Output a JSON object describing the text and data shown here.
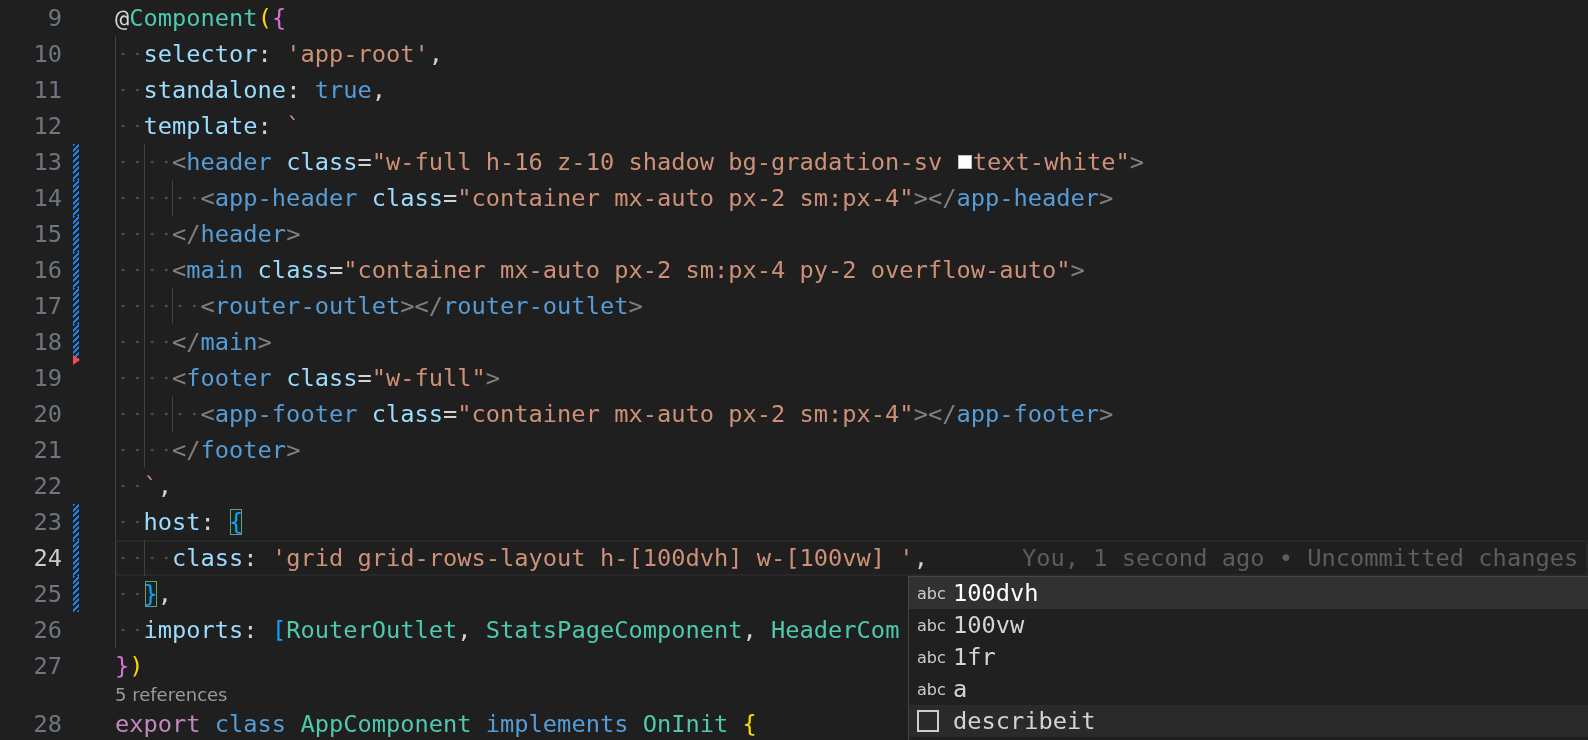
{
  "rows": [
    {
      "kind": "code",
      "number": "9",
      "current": false,
      "modified": false,
      "deleted_after": false,
      "tokens": [
        {
          "kind": "plain",
          "text": "@"
        },
        {
          "kind": "type",
          "text": "Component"
        },
        {
          "kind": "paren",
          "text": "("
        },
        {
          "kind": "brace",
          "text": "{"
        }
      ]
    },
    {
      "kind": "code",
      "number": "10",
      "current": false,
      "modified": false,
      "deleted_after": false,
      "tokens": [
        {
          "kind": "prop",
          "text": "  selector"
        },
        {
          "kind": "plain",
          "text": ": "
        },
        {
          "kind": "string",
          "text": "'app-root'"
        },
        {
          "kind": "plain",
          "text": ","
        }
      ]
    },
    {
      "kind": "code",
      "number": "11",
      "current": false,
      "modified": false,
      "deleted_after": false,
      "tokens": [
        {
          "kind": "prop",
          "text": "  standalone"
        },
        {
          "kind": "plain",
          "text": ": "
        },
        {
          "kind": "literal",
          "text": "true"
        },
        {
          "kind": "plain",
          "text": ","
        }
      ]
    },
    {
      "kind": "code",
      "number": "12",
      "current": false,
      "modified": false,
      "deleted_after": false,
      "tokens": [
        {
          "kind": "prop",
          "text": "  template"
        },
        {
          "kind": "plain",
          "text": ": "
        },
        {
          "kind": "string",
          "text": "`"
        }
      ]
    },
    {
      "kind": "code",
      "number": "13",
      "current": false,
      "modified": true,
      "deleted_after": false,
      "tokens": [
        {
          "kind": "punct",
          "text": "    <"
        },
        {
          "kind": "tag",
          "text": "header"
        },
        {
          "kind": "prop",
          "text": " class"
        },
        {
          "kind": "plain",
          "text": "="
        },
        {
          "kind": "string",
          "text": "\"w-full h-16 z-10 shadow bg-gradation-sv "
        },
        {
          "kind": "swatch",
          "color": "#ffffff"
        },
        {
          "kind": "string",
          "text": "text-white\""
        },
        {
          "kind": "punct",
          "text": ">"
        }
      ]
    },
    {
      "kind": "code",
      "number": "14",
      "current": false,
      "modified": true,
      "deleted_after": false,
      "tokens": [
        {
          "kind": "punct",
          "text": "      <"
        },
        {
          "kind": "tag",
          "text": "app-header"
        },
        {
          "kind": "prop",
          "text": " class"
        },
        {
          "kind": "plain",
          "text": "="
        },
        {
          "kind": "string",
          "text": "\"container mx-auto px-2 sm:px-4\""
        },
        {
          "kind": "punct",
          "text": "></"
        },
        {
          "kind": "tag",
          "text": "app-header"
        },
        {
          "kind": "punct",
          "text": ">"
        }
      ]
    },
    {
      "kind": "code",
      "number": "15",
      "current": false,
      "modified": true,
      "deleted_after": false,
      "tokens": [
        {
          "kind": "punct",
          "text": "    </"
        },
        {
          "kind": "tag",
          "text": "header"
        },
        {
          "kind": "punct",
          "text": ">"
        }
      ]
    },
    {
      "kind": "code",
      "number": "16",
      "current": false,
      "modified": true,
      "deleted_after": false,
      "tokens": [
        {
          "kind": "punct",
          "text": "    <"
        },
        {
          "kind": "tag",
          "text": "main"
        },
        {
          "kind": "prop",
          "text": " class"
        },
        {
          "kind": "plain",
          "text": "="
        },
        {
          "kind": "string",
          "text": "\"container mx-auto px-2 sm:px-4 py-2 overflow-auto\""
        },
        {
          "kind": "punct",
          "text": ">"
        }
      ]
    },
    {
      "kind": "code",
      "number": "17",
      "current": false,
      "modified": true,
      "deleted_after": false,
      "tokens": [
        {
          "kind": "punct",
          "text": "      <"
        },
        {
          "kind": "tag",
          "text": "router-outlet"
        },
        {
          "kind": "punct",
          "text": "></"
        },
        {
          "kind": "tag",
          "text": "router-outlet"
        },
        {
          "kind": "punct",
          "text": ">"
        }
      ]
    },
    {
      "kind": "code",
      "number": "18",
      "current": false,
      "modified": true,
      "deleted_after": true,
      "tokens": [
        {
          "kind": "punct",
          "text": "    </"
        },
        {
          "kind": "tag",
          "text": "main"
        },
        {
          "kind": "punct",
          "text": ">"
        }
      ]
    },
    {
      "kind": "code",
      "number": "19",
      "current": false,
      "modified": false,
      "deleted_after": false,
      "tokens": [
        {
          "kind": "punct",
          "text": "    <"
        },
        {
          "kind": "tag",
          "text": "footer"
        },
        {
          "kind": "prop",
          "text": " class"
        },
        {
          "kind": "plain",
          "text": "="
        },
        {
          "kind": "string",
          "text": "\"w-full\""
        },
        {
          "kind": "punct",
          "text": ">"
        }
      ]
    },
    {
      "kind": "code",
      "number": "20",
      "current": false,
      "modified": false,
      "deleted_after": false,
      "tokens": [
        {
          "kind": "punct",
          "text": "      <"
        },
        {
          "kind": "tag",
          "text": "app-footer"
        },
        {
          "kind": "prop",
          "text": " class"
        },
        {
          "kind": "plain",
          "text": "="
        },
        {
          "kind": "string",
          "text": "\"container mx-auto px-2 sm:px-4\""
        },
        {
          "kind": "punct",
          "text": "></"
        },
        {
          "kind": "tag",
          "text": "app-footer"
        },
        {
          "kind": "punct",
          "text": ">"
        }
      ]
    },
    {
      "kind": "code",
      "number": "21",
      "current": false,
      "modified": false,
      "deleted_after": false,
      "tokens": [
        {
          "kind": "punct",
          "text": "    </"
        },
        {
          "kind": "tag",
          "text": "footer"
        },
        {
          "kind": "punct",
          "text": ">"
        }
      ]
    },
    {
      "kind": "code",
      "number": "22",
      "current": false,
      "modified": false,
      "deleted_after": false,
      "tokens": [
        {
          "kind": "string",
          "text": "  `"
        },
        {
          "kind": "plain",
          "text": ","
        }
      ]
    },
    {
      "kind": "code",
      "number": "23",
      "current": false,
      "modified": true,
      "deleted_after": false,
      "tokens": [
        {
          "kind": "prop",
          "text": "  host"
        },
        {
          "kind": "plain",
          "text": ": "
        },
        {
          "kind": "matched_bracket",
          "text": "{"
        }
      ]
    },
    {
      "kind": "code",
      "number": "24",
      "current": true,
      "modified": true,
      "deleted_after": false,
      "blame": "You, 1 second ago • Uncommitted changes",
      "tokens": [
        {
          "kind": "prop",
          "text": "    class"
        },
        {
          "kind": "plain",
          "text": ": "
        },
        {
          "kind": "string",
          "text": "'grid grid-rows-layout h-[100dvh] w-[100vw] '"
        },
        {
          "kind": "plain",
          "text": ","
        }
      ]
    },
    {
      "kind": "code",
      "number": "25",
      "current": false,
      "modified": true,
      "deleted_after": false,
      "tokens": [
        {
          "kind": "matched_bracket",
          "text": "  }"
        },
        {
          "kind": "plain",
          "text": ","
        }
      ]
    },
    {
      "kind": "code",
      "number": "26",
      "current": false,
      "modified": false,
      "deleted_after": false,
      "tokens": [
        {
          "kind": "prop",
          "text": "  imports"
        },
        {
          "kind": "plain",
          "text": ": "
        },
        {
          "kind": "bracket",
          "text": "["
        },
        {
          "kind": "type",
          "text": "RouterOutlet"
        },
        {
          "kind": "plain",
          "text": ", "
        },
        {
          "kind": "type",
          "text": "StatsPageComponent"
        },
        {
          "kind": "plain",
          "text": ", "
        },
        {
          "kind": "type",
          "text": "HeaderCom"
        }
      ]
    },
    {
      "kind": "code",
      "number": "27",
      "current": false,
      "modified": false,
      "deleted_after": false,
      "tokens": [
        {
          "kind": "brace",
          "text": "}"
        },
        {
          "kind": "paren",
          "text": ")"
        }
      ]
    },
    {
      "kind": "lens",
      "text": "5 references"
    },
    {
      "kind": "code",
      "number": "28",
      "current": false,
      "modified": false,
      "deleted_after": false,
      "tokens": [
        {
          "kind": "keyword",
          "text": "export "
        },
        {
          "kind": "literal",
          "text": "class "
        },
        {
          "kind": "type",
          "text": "AppComponent "
        },
        {
          "kind": "literal",
          "text": "implements "
        },
        {
          "kind": "type",
          "text": "OnInit "
        },
        {
          "kind": "paren",
          "text": "{"
        }
      ]
    }
  ],
  "suggestions": [
    {
      "kind": "text",
      "icon_text": "abc",
      "label": "100dvh",
      "selected": true
    },
    {
      "kind": "text",
      "icon_text": "abc",
      "label": "100vw",
      "selected": false
    },
    {
      "kind": "text",
      "icon_text": "abc",
      "label": "1fr",
      "selected": false
    },
    {
      "kind": "text",
      "icon_text": "abc",
      "label": "a",
      "selected": false
    },
    {
      "kind": "snippet",
      "label": "describeit",
      "selected": false
    }
  ]
}
